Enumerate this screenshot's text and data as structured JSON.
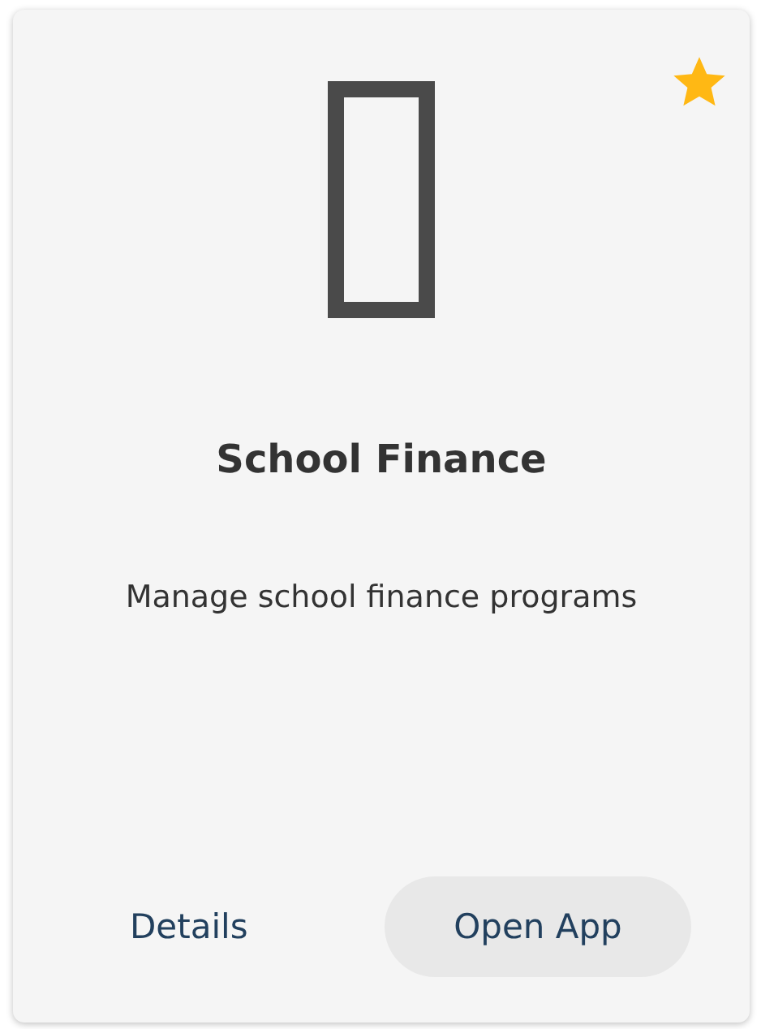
{
  "card": {
    "favorite": true,
    "title": "School Finance",
    "description": "Manage school finance programs",
    "actions": [
      {
        "kind": "link",
        "label": "Details"
      },
      {
        "kind": "button",
        "label": "Open App"
      }
    ]
  }
}
